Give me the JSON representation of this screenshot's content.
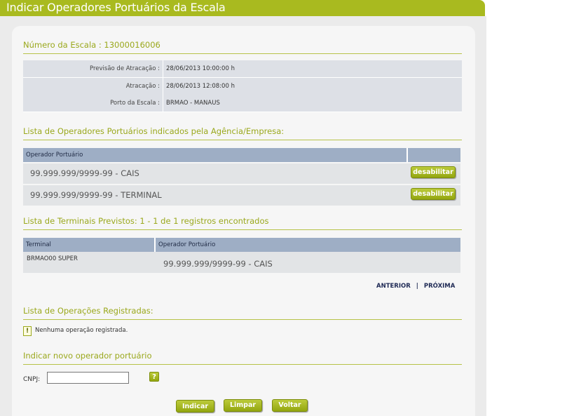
{
  "window": {
    "title": "Indicar Operadores Portuários da Escala"
  },
  "escala": {
    "heading": "Número da Escala : 13000016006",
    "rows": [
      {
        "label": "Previsão de Atracação :",
        "value": "28/06/2013  10:00:00 h"
      },
      {
        "label": "Atracação :",
        "value": "28/06/2013  12:08:00 h"
      },
      {
        "label": "Porto da Escala :",
        "value": "BRMAO  -  MANAUS"
      }
    ]
  },
  "operadores": {
    "heading": "Lista de Operadores Portuários indicados pela Agência/Empresa:",
    "column": "Operador Portuário",
    "rows": [
      {
        "name": "99.999.999/9999-99 - CAIS",
        "action": "desabilitar"
      },
      {
        "name": "99.999.999/9999-99 - TERMINAL",
        "action": "desabilitar"
      }
    ]
  },
  "terminais": {
    "heading": "Lista de Terminais Previstos: 1 - 1 de 1 registros encontrados",
    "columns": [
      "Terminal",
      "Operador Portuário"
    ],
    "rows": [
      {
        "terminal": "BRMAO00    SUPER",
        "operador": "99.999.999/9999-99 - CAIS"
      }
    ]
  },
  "pager": {
    "prev": "ANTERIOR",
    "separator": "|",
    "next": "PRÓXIMA"
  },
  "operacoes": {
    "heading": "Lista de Operações Registradas:",
    "warning_icon": "!",
    "empty_message": "Nenhuma operação registrada."
  },
  "novo": {
    "heading": "Indicar novo operador portuário",
    "cnpj_label": "CNPJ:",
    "cnpj_value": "",
    "help_icon": "?"
  },
  "actions": {
    "indicar": "Indicar",
    "limpar": "Limpar",
    "voltar": "Voltar"
  },
  "colors": {
    "accent": "#a9ba1f",
    "header_blue": "#9eaec5",
    "row_grey": "#dde0e6"
  }
}
